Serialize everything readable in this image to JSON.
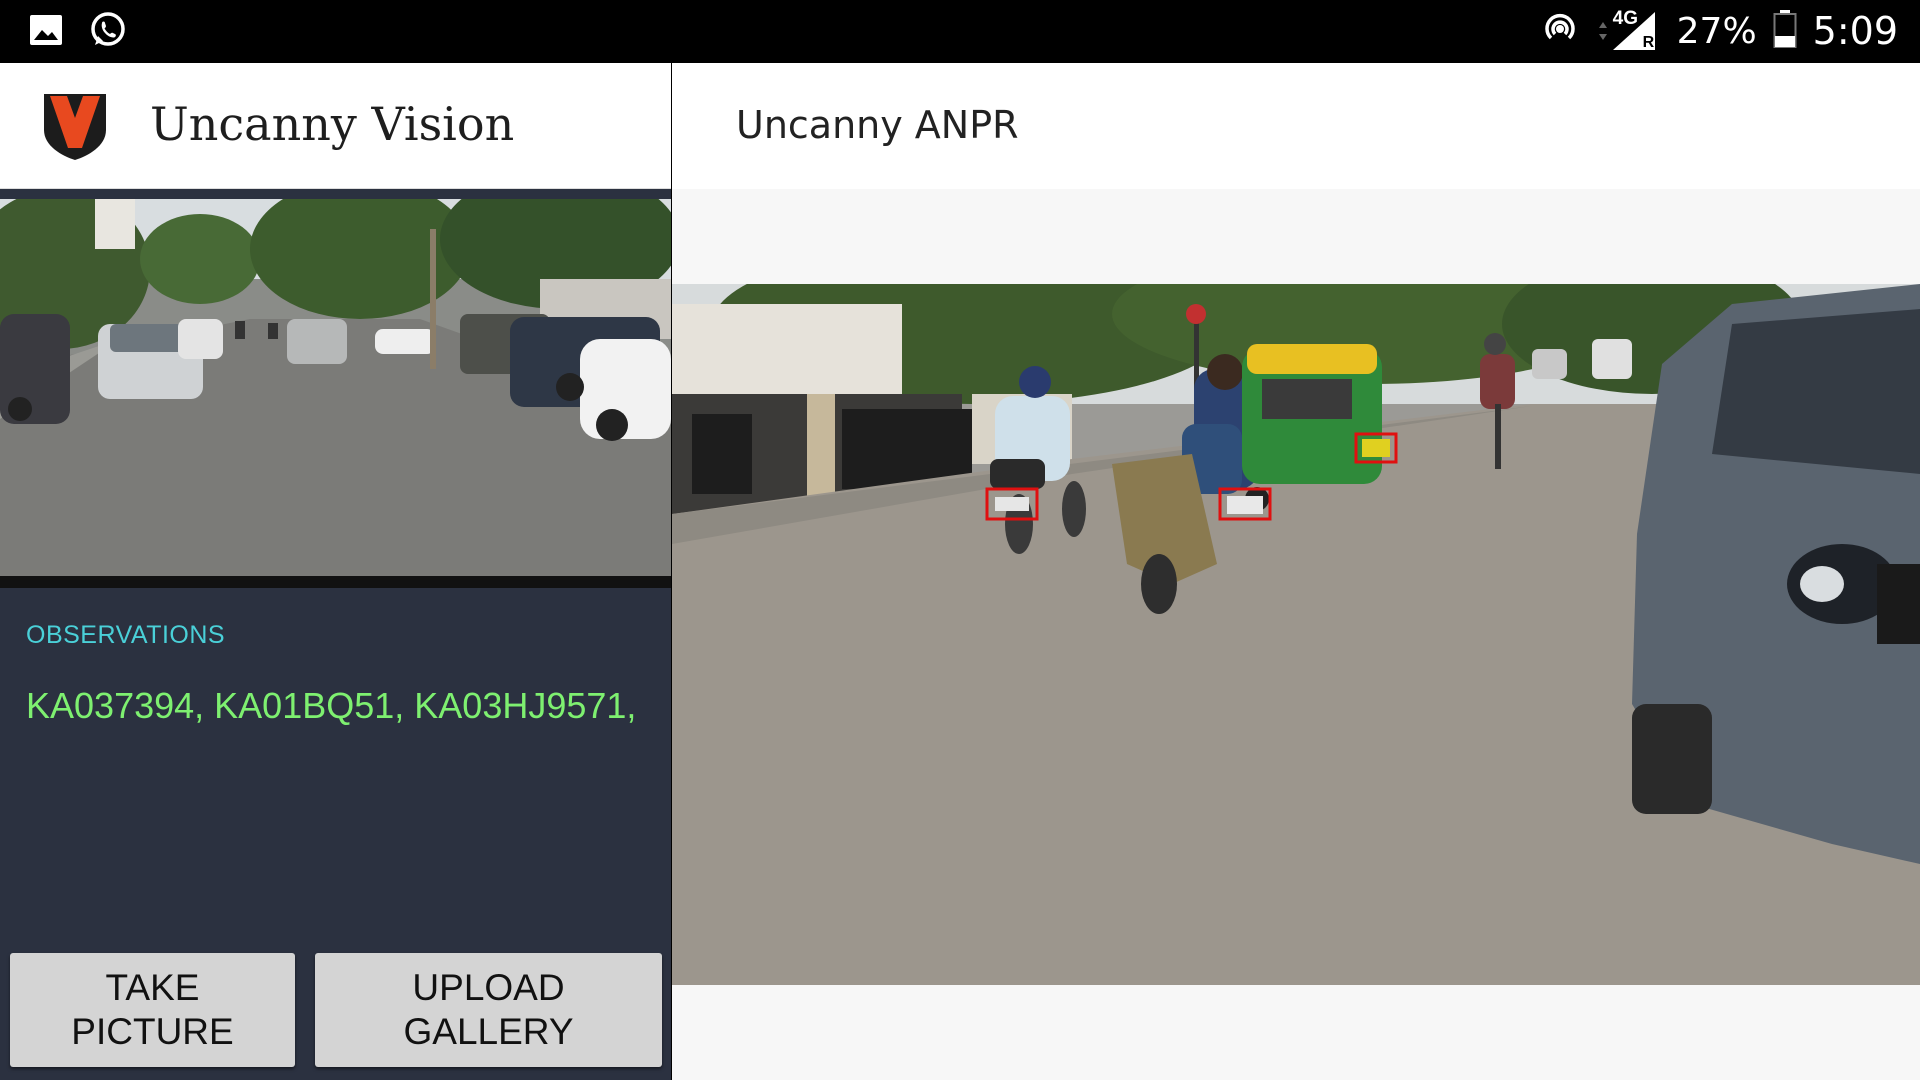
{
  "status_bar": {
    "left_icons": [
      "gallery-icon",
      "whatsapp-icon"
    ],
    "right_icons": [
      "hotspot-icon",
      "data-arrows-icon",
      "signal-icon",
      "battery-icon"
    ],
    "network": "4G",
    "roaming": "R",
    "battery": "27%",
    "time": "5:09"
  },
  "left_panel": {
    "app_title": "Uncanny Vision",
    "logo_colors": {
      "shield": "#1c1c1c",
      "v": "#e8491f"
    },
    "observations_label": "OBSERVATIONS",
    "observations_value": "KA037394, KA01BQ51, KA03HJ9571,",
    "buttons": {
      "take_line1": "TAKE",
      "take_line2": "PICTURE",
      "upload_line1": "UPLOAD",
      "upload_line2": "GALLERY"
    }
  },
  "right_panel": {
    "title": "Uncanny ANPR"
  },
  "colors": {
    "accent_cyan": "#4ad0d8",
    "plate_text_green": "#7ef070",
    "panel_dark": "#2b3140",
    "detection_box": "#e01010"
  }
}
